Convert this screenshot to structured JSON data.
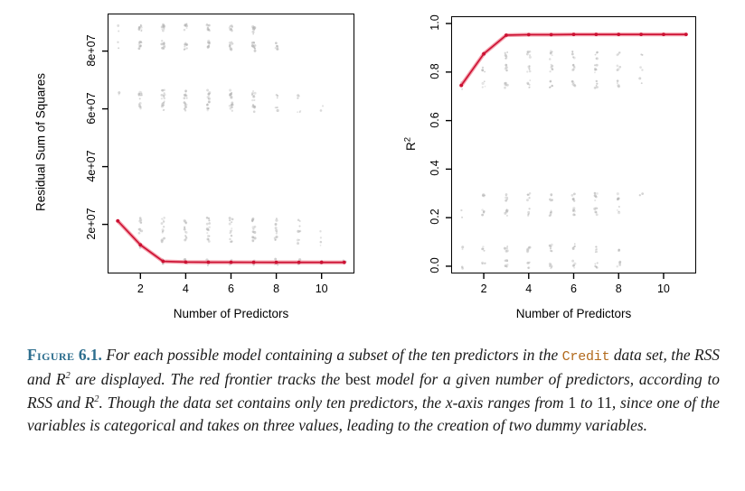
{
  "figure": {
    "label": "Figure",
    "number": "6.1.",
    "caption_segments": [
      {
        "type": "text",
        "value": " For each possible model containing a subset of the ten predictors in the "
      },
      {
        "type": "mono",
        "value": "Credit"
      },
      {
        "type": "text",
        "value": " data set, the RSS and R"
      },
      {
        "type": "sup",
        "value": "2"
      },
      {
        "type": "text",
        "value": " are displayed. The red frontier tracks the "
      },
      {
        "type": "upright",
        "value": "best"
      },
      {
        "type": "text",
        "value": " model for a given number of predictors, according to RSS and R"
      },
      {
        "type": "sup",
        "value": "2"
      },
      {
        "type": "text",
        "value": ". Though the data set contains only ten predictors, the x-axis ranges from "
      },
      {
        "type": "upright",
        "value": "1"
      },
      {
        "type": "text",
        "value": " to "
      },
      {
        "type": "upright",
        "value": "11"
      },
      {
        "type": "text",
        "value": ", since one of the variables is categorical and takes on three values, leading to the creation of two dummy variables."
      }
    ],
    "label_color": "#2d6e8e",
    "mono_color": "#b26a1d"
  },
  "chart_data": [
    {
      "id": "rss",
      "type": "scatter",
      "title": "",
      "xlabel": "Number of Predictors",
      "ylabel": "Residual Sum of Squares",
      "xlim": [
        0.55,
        11.45
      ],
      "ylim": [
        3000000,
        93000000
      ],
      "xticks": [
        2,
        4,
        6,
        8,
        10
      ],
      "xticklabels": [
        "2",
        "4",
        "6",
        "8",
        "10"
      ],
      "yticks": [
        20000000,
        40000000,
        60000000,
        80000000
      ],
      "yticklabels": [
        "2e+07",
        "4e+07",
        "6e+07",
        "8e+07"
      ],
      "grid": false,
      "point_color": "#b4b4b4",
      "frontier_color": "#cc1133",
      "frontier_halo_color": "#f08090",
      "frontier": {
        "name": "Best model (red frontier)",
        "x": [
          1,
          2,
          3,
          4,
          5,
          6,
          7,
          8,
          9,
          10,
          11
        ],
        "y": [
          21200000,
          12900000,
          7200000,
          6950000,
          6900000,
          6880000,
          6870000,
          6860000,
          6855000,
          6850000,
          6850000
        ]
      },
      "cloud_note": "All 2^p subset models plotted as light grey points; clusters by predictor count.",
      "clusters": [
        {
          "x": 1,
          "y": [
            88000000,
            82000000,
            65000000,
            21400000
          ]
        },
        {
          "x": 2,
          "y": [
            88500000,
            88000000,
            82500000,
            81500000,
            65500000,
            64500000,
            61000000,
            21200000,
            18000000,
            13000000
          ]
        },
        {
          "x": 3,
          "y": [
            88500000,
            88000000,
            82500000,
            81500000,
            65500000,
            64500000,
            61500000,
            60500000,
            21200000,
            18000000,
            15000000,
            7400000
          ]
        },
        {
          "x": 4,
          "y": [
            88500000,
            88000000,
            82500000,
            81500000,
            65500000,
            64500000,
            61500000,
            60500000,
            21200000,
            18000000,
            15000000,
            7000000
          ]
        },
        {
          "x": 5,
          "y": [
            88500000,
            88000000,
            82500000,
            81500000,
            65500000,
            64500000,
            61500000,
            60500000,
            21200000,
            18000000,
            15000000,
            6900000
          ]
        },
        {
          "x": 6,
          "y": [
            88500000,
            88000000,
            82500000,
            81500000,
            65500000,
            64500000,
            61500000,
            60500000,
            21200000,
            18000000,
            15000000,
            6880000
          ]
        },
        {
          "x": 7,
          "y": [
            88000000,
            87000000,
            82000000,
            81000000,
            65000000,
            64000000,
            61000000,
            60000000,
            21000000,
            18000000,
            15000000,
            6870000
          ]
        },
        {
          "x": 8,
          "y": [
            82000000,
            81000000,
            64500000,
            60500000,
            21000000,
            18000000,
            15000000,
            6860000
          ]
        },
        {
          "x": 9,
          "y": [
            64000000,
            60000000,
            20500000,
            17500000,
            14500000,
            6855000
          ]
        },
        {
          "x": 10,
          "y": [
            60000000,
            16500000,
            13500000,
            6850000
          ]
        },
        {
          "x": 11,
          "y": [
            6850000
          ]
        }
      ]
    },
    {
      "id": "r2",
      "type": "scatter",
      "title": "",
      "xlabel": "Number of Predictors",
      "ylabel": "R2",
      "ylabel_base": "R",
      "ylabel_sup": "2",
      "xlim": [
        0.55,
        11.45
      ],
      "ylim": [
        -0.03,
        1.03
      ],
      "xticks": [
        2,
        4,
        6,
        8,
        10
      ],
      "xticklabels": [
        "2",
        "4",
        "6",
        "8",
        "10"
      ],
      "yticks": [
        0.0,
        0.2,
        0.4,
        0.6,
        0.8,
        1.0
      ],
      "yticklabels": [
        "0.0",
        "0.2",
        "0.4",
        "0.6",
        "0.8",
        "1.0"
      ],
      "grid": false,
      "point_color": "#b4b4b4",
      "frontier_color": "#cc1133",
      "frontier_halo_color": "#f08090",
      "frontier": {
        "name": "Best model (red frontier)",
        "x": [
          1,
          2,
          3,
          4,
          5,
          6,
          7,
          8,
          9,
          10,
          11
        ],
        "y": [
          0.745,
          0.875,
          0.952,
          0.954,
          0.954,
          0.955,
          0.955,
          0.955,
          0.955,
          0.955,
          0.955
        ]
      },
      "cloud_note": "All 2^p subset models plotted as light grey points; clusters by predictor count.",
      "clusters": [
        {
          "x": 1,
          "y": [
            0.745,
            0.215,
            0.07,
            0.005
          ]
        },
        {
          "x": 2,
          "y": [
            0.875,
            0.815,
            0.75,
            0.285,
            0.22,
            0.075,
            0.008
          ]
        },
        {
          "x": 3,
          "y": [
            0.87,
            0.815,
            0.75,
            0.285,
            0.22,
            0.075,
            0.008
          ]
        },
        {
          "x": 4,
          "y": [
            0.87,
            0.815,
            0.75,
            0.285,
            0.22,
            0.075,
            0.008
          ]
        },
        {
          "x": 5,
          "y": [
            0.87,
            0.815,
            0.75,
            0.285,
            0.22,
            0.075,
            0.008
          ]
        },
        {
          "x": 6,
          "y": [
            0.87,
            0.815,
            0.75,
            0.285,
            0.225,
            0.075,
            0.008
          ]
        },
        {
          "x": 7,
          "y": [
            0.87,
            0.815,
            0.75,
            0.285,
            0.225,
            0.075,
            0.008
          ]
        },
        {
          "x": 8,
          "y": [
            0.87,
            0.82,
            0.755,
            0.285,
            0.23,
            0.07,
            0.005
          ]
        },
        {
          "x": 9,
          "y": [
            0.87,
            0.825,
            0.76,
            0.29
          ]
        }
      ]
    }
  ]
}
